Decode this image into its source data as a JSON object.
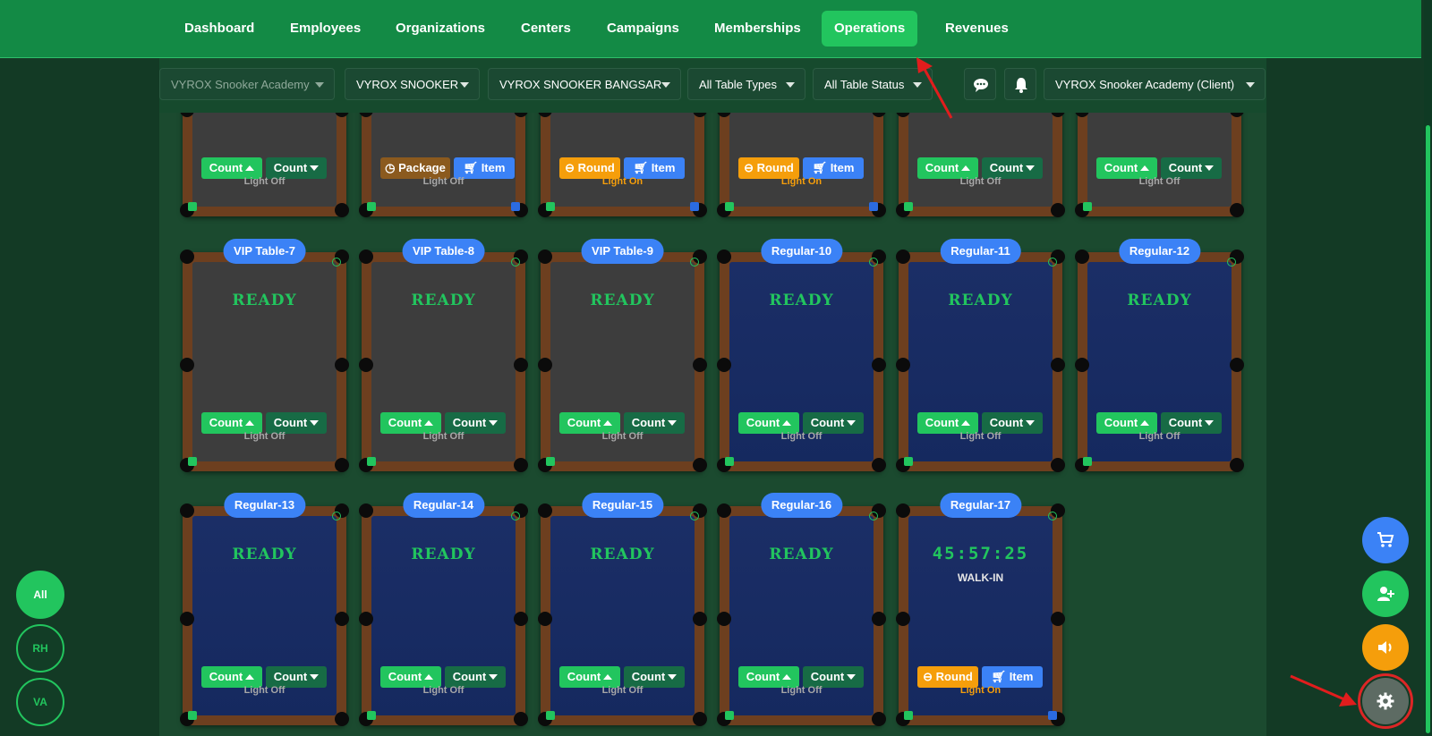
{
  "nav": [
    "Dashboard",
    "Employees",
    "Organizations",
    "Centers",
    "Campaigns",
    "Memberships",
    "Operations",
    "Revenues"
  ],
  "nav_active": "Operations",
  "filters": {
    "academy": "VYROX Snooker Academy",
    "brand": "VYROX SNOOKER",
    "branch": "VYROX SNOOKER BANGSAR",
    "table_types": "All Table Types",
    "table_status": "All Table Status",
    "client": "VYROX Snooker Academy (Client)"
  },
  "labels": {
    "ready": "READY",
    "count": "Count",
    "package": "Package",
    "round": "Round",
    "item": "Item",
    "light_off": "Light Off",
    "light_on": "Light On"
  },
  "top_row": [
    {
      "buttons": "count",
      "light": "Light Off"
    },
    {
      "buttons": "package",
      "light": "Light Off"
    },
    {
      "buttons": "round",
      "light": "Light On"
    },
    {
      "buttons": "round",
      "light": "Light On"
    },
    {
      "buttons": "count",
      "light": "Light Off"
    },
    {
      "buttons": "count",
      "light": "Light Off"
    }
  ],
  "tables_row2": [
    {
      "name": "VIP Table-7",
      "felt": "gray",
      "status": "READY",
      "light": "Light Off"
    },
    {
      "name": "VIP Table-8",
      "felt": "gray",
      "status": "READY",
      "light": "Light Off"
    },
    {
      "name": "VIP Table-9",
      "felt": "gray",
      "status": "READY",
      "light": "Light Off"
    },
    {
      "name": "Regular-10",
      "felt": "blue",
      "status": "READY",
      "light": "Light Off"
    },
    {
      "name": "Regular-11",
      "felt": "blue",
      "status": "READY",
      "light": "Light Off"
    },
    {
      "name": "Regular-12",
      "felt": "blue",
      "status": "READY",
      "light": "Light Off"
    }
  ],
  "tables_row3": [
    {
      "name": "Regular-13",
      "felt": "blue",
      "status": "READY",
      "light": "Light Off"
    },
    {
      "name": "Regular-14",
      "felt": "blue",
      "status": "READY",
      "light": "Light Off"
    },
    {
      "name": "Regular-15",
      "felt": "blue",
      "status": "READY",
      "light": "Light Off"
    },
    {
      "name": "Regular-16",
      "felt": "blue",
      "status": "READY",
      "light": "Light Off"
    },
    {
      "name": "Regular-17",
      "felt": "blue",
      "timer": "45:57:25",
      "mode": "WALK-IN",
      "light": "Light On"
    }
  ],
  "side_filters": [
    "All",
    "RH",
    "VA"
  ],
  "side_active": "All",
  "colors": {
    "green": "#22c55e",
    "blue": "#3b82f6",
    "orange": "#f59e0b",
    "nav_bg": "#138a45"
  },
  "fab_icons": [
    "cart-icon",
    "add-user-icon",
    "speaker-icon",
    "gear-icon"
  ]
}
